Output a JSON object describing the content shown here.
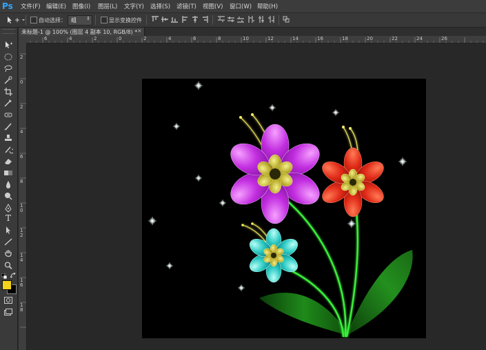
{
  "app": {
    "logo": "Ps"
  },
  "menu": [
    "文件(F)",
    "编辑(E)",
    "图像(I)",
    "图层(L)",
    "文字(Y)",
    "选择(S)",
    "滤镜(T)",
    "视图(V)",
    "窗口(W)",
    "帮助(H)"
  ],
  "options_bar": {
    "auto_select_label": "自动选择：",
    "auto_select_value": "组",
    "show_transform_label": "显示变换控件"
  },
  "document_tab": {
    "title": "未标题-1 @ 100% (图层 4 副本 10, RGB/8) *",
    "close": "×"
  },
  "ruler": {
    "h_ticks": [
      "6",
      "4",
      "2",
      "0",
      "2",
      "4",
      "6",
      "8",
      "10",
      "12",
      "14",
      "16",
      "18",
      "20",
      "22",
      "24",
      "26"
    ],
    "v_ticks": [
      "2",
      "0",
      "2",
      "4",
      "6",
      "8",
      "1\n0",
      "1\n2",
      "1\n4",
      "1\n6",
      "1\n8"
    ]
  },
  "colors": {
    "foreground": "#f2d21b",
    "background": "#000000"
  },
  "tools": [
    "move-tool",
    "marquee-tool",
    "lasso-tool",
    "quick-select-tool",
    "crop-tool",
    "eyedropper-tool",
    "spot-heal-tool",
    "brush-tool",
    "clone-stamp-tool",
    "history-brush-tool",
    "eraser-tool",
    "gradient-tool",
    "blur-tool",
    "dodge-tool",
    "pen-tool",
    "type-tool",
    "path-select-tool",
    "line-tool",
    "hand-tool",
    "zoom-tool"
  ]
}
